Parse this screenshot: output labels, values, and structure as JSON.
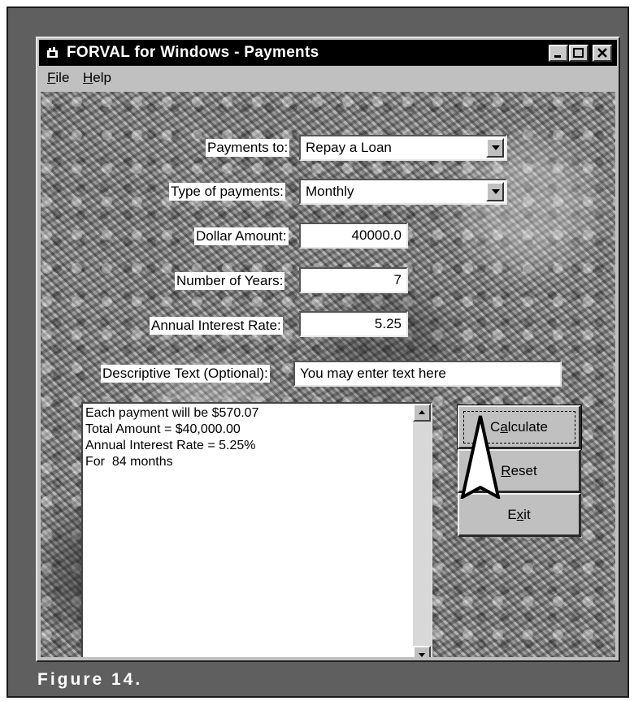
{
  "window": {
    "title": "FORVAL for Windows - Payments",
    "menu": [
      {
        "label": "File",
        "mnemonic": "F",
        "rest": "ile"
      },
      {
        "label": "Help",
        "mnemonic": "H",
        "rest": "elp"
      }
    ]
  },
  "form": {
    "payments_to_label": "Payments to:",
    "payments_to_value": "Repay a Loan",
    "type_label": "Type of payments:",
    "type_value": "Monthly",
    "dollar_label": "Dollar Amount:",
    "dollar_value": "40000.0",
    "years_label": "Number of Years:",
    "years_value": "7",
    "rate_label": "Annual Interest Rate:",
    "rate_value": "5.25",
    "desc_label": "Descriptive Text (Optional):",
    "desc_value": "You may enter text here"
  },
  "output": {
    "lines": [
      "Each payment will be $570.07",
      "",
      "Total Amount = $40,000.00",
      "Annual Interest Rate = 5.25%",
      "For  84 months"
    ]
  },
  "buttons": {
    "calculate": {
      "pre": "C",
      "mnemonic": "a",
      "post": "lculate"
    },
    "reset": {
      "pre": "",
      "mnemonic": "R",
      "post": "eset"
    },
    "exit": {
      "pre": "E",
      "mnemonic": "x",
      "post": "it"
    }
  },
  "caption": "Figure 14."
}
